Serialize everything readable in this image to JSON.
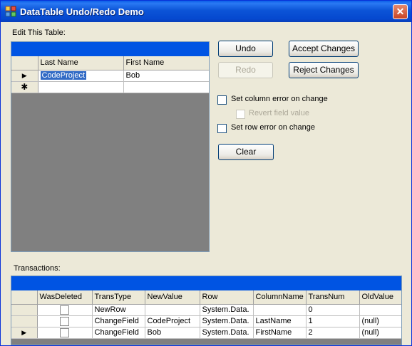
{
  "window": {
    "title": "DataTable Undo/Redo Demo",
    "close_glyph": "✕"
  },
  "edit_table": {
    "label": "Edit This Table:",
    "columns": [
      "Last Name",
      "First Name"
    ],
    "rows": [
      {
        "last_name": "CodeProject",
        "first_name": "Bob"
      }
    ],
    "new_row_marker": "✱",
    "current_row_marker": "▶"
  },
  "buttons": {
    "undo": "Undo",
    "redo": "Redo",
    "accept_changes": "Accept Changes",
    "reject_changes": "Reject Changes",
    "clear": "Clear"
  },
  "options": {
    "set_column_error": "Set column error on change",
    "revert_field_value": "Revert field value",
    "set_row_error": "Set row error on change"
  },
  "transactions": {
    "label": "Transactions:",
    "columns": [
      "WasDeleted",
      "TransType",
      "NewValue",
      "Row",
      "ColumnName",
      "TransNum",
      "OldValue"
    ],
    "rows": [
      {
        "trans_type": "NewRow",
        "new_value": "",
        "row": "System.Data.",
        "column_name": "",
        "trans_num": "0",
        "old_value": ""
      },
      {
        "trans_type": "ChangeField",
        "new_value": "CodeProject",
        "row": "System.Data.",
        "column_name": "LastName",
        "trans_num": "1",
        "old_value": "(null)"
      },
      {
        "trans_type": "ChangeField",
        "new_value": "Bob",
        "row": "System.Data.",
        "column_name": "FirstName",
        "trans_num": "2",
        "old_value": "(null)"
      }
    ]
  }
}
